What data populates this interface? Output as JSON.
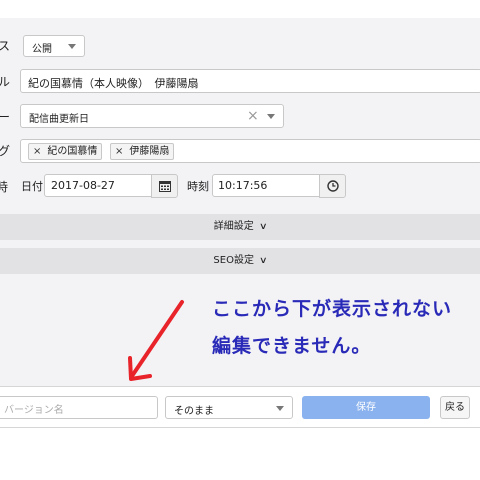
{
  "form": {
    "status_label_fragment": "ス",
    "status_value": "公開",
    "title_label_fragment": "ル",
    "title_value": "紀の国慕情（本人映像）　伊藤陽扇",
    "sort_label_fragment": "ー",
    "sort_value": "配信曲更新日",
    "tags_label_fragment": "グ",
    "tags": [
      "紀の国慕情",
      "伊藤陽扇"
    ],
    "datetime_label_fragment": "時",
    "date_label": "日付",
    "date_value": "2017-08-27",
    "time_label": "時刻",
    "time_value": "10:17:56",
    "clear_symbol": "×"
  },
  "sections": {
    "details": "詳細設定",
    "seo": "SEO設定"
  },
  "annotation": {
    "line1": "ここから下が表示されない",
    "line2": "編集できません。"
  },
  "footer": {
    "version_placeholder": "バージョン名",
    "mode_value": "そのまま",
    "save_label": "保存",
    "back_label": "戻る"
  },
  "colors": {
    "panel": "#f3f3f5",
    "section_bar": "#e2e2e5",
    "save_button": "#8ab2ee",
    "annotation_text": "#2a2ab8",
    "arrow": "#e8232a"
  }
}
